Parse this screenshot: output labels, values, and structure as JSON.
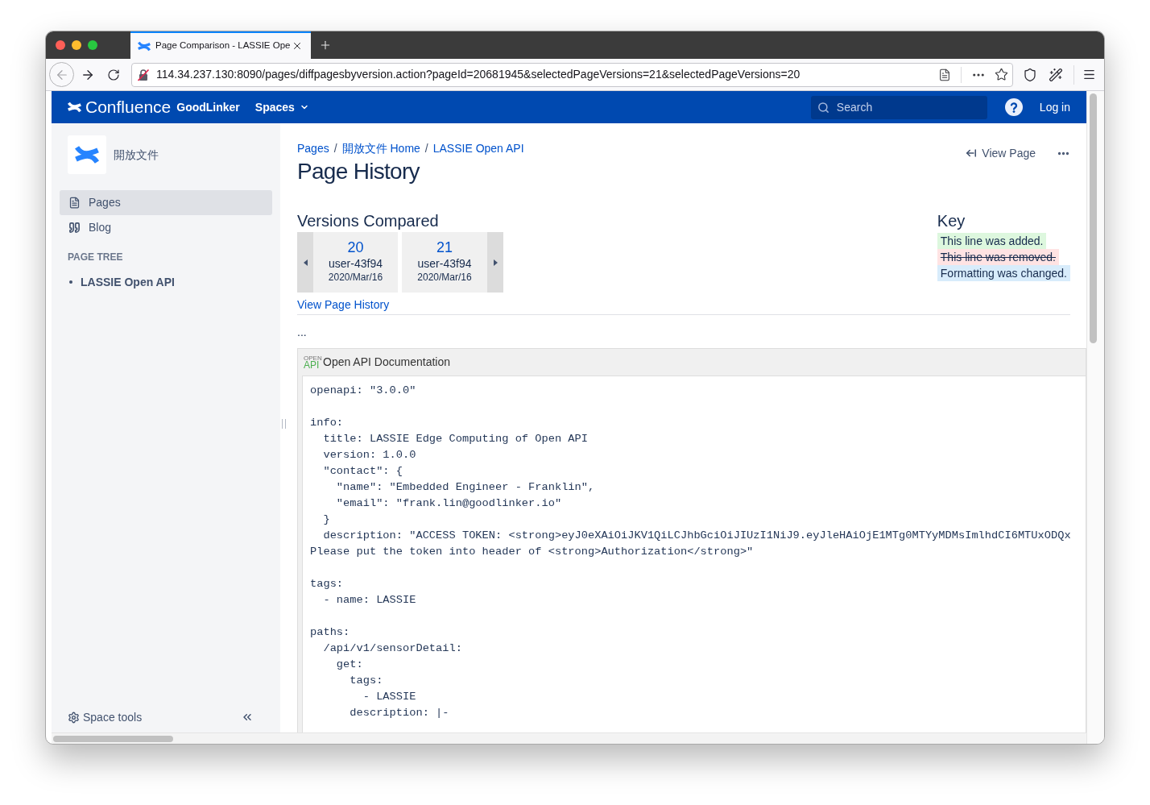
{
  "browser": {
    "tabs": [
      {
        "title": "Page Comparison - LASSIE Ope",
        "selected": true
      }
    ],
    "url": "114.34.237.130:8090/pages/diffpagesbyversion.action?pageId=20681945&selectedPageVersions=21&selectedPageVersions=20"
  },
  "header": {
    "product": "Confluence",
    "site": "GoodLinker",
    "menu": [
      {
        "label": "Spaces"
      }
    ],
    "search": {
      "placeholder": "Search"
    },
    "login": "Log in"
  },
  "sidebar": {
    "space_name": "開放文件",
    "nav": [
      {
        "kind": "pages",
        "label": "Pages",
        "selected": true
      },
      {
        "kind": "blog",
        "label": "Blog",
        "selected": false
      }
    ],
    "section_title": "PAGE TREE",
    "tree": [
      {
        "label": "LASSIE Open API"
      }
    ],
    "footer": {
      "label": "Space tools"
    }
  },
  "page": {
    "breadcrumbs": {
      "items": [
        "Pages",
        "開放文件 Home",
        "LASSIE Open API"
      ],
      "separator": "/"
    },
    "title": "Page History",
    "view_page": "View Page",
    "versions": {
      "title": "Versions Compared",
      "items": [
        {
          "number": "20",
          "author": "user-43f94",
          "date": "2020/Mar/16"
        },
        {
          "number": "21",
          "author": "user-43f94",
          "date": "2020/Mar/16"
        }
      ],
      "history_link": "View Page History"
    },
    "key": {
      "title": "Key",
      "items": [
        {
          "kind": "added",
          "text": "This line was added."
        },
        {
          "kind": "removed",
          "text": "This line was removed."
        },
        {
          "kind": "changed",
          "text": "Formatting was changed."
        }
      ]
    },
    "gap_marker": "...",
    "macro": {
      "logo": {
        "top": "OPEN",
        "bottom": "API"
      },
      "title": "Open API Documentation",
      "code": "openapi: \"3.0.0\"\n\ninfo:\n  title: LASSIE Edge Computing of Open API\n  version: 1.0.0\n  \"contact\": {\n    \"name\": \"Embedded Engineer - Franklin\",\n    \"email\": \"frank.lin@goodlinker.io\"\n  }\n  description: \"ACCESS TOKEN: <strong>eyJ0eXAiOiJKV1QiLCJhbGciOiJIUzI1NiJ9.eyJleHAiOjE1MTg0MTYyMDMsImlhdCI6MTUxODQx\nPlease put the token into header of <strong>Authorization</strong>\"\n\ntags:\n  - name: LASSIE\n\npaths:\n  /api/v1/sensorDetail:\n    get:\n      tags:\n        - LASSIE\n      description: |-"
    }
  }
}
